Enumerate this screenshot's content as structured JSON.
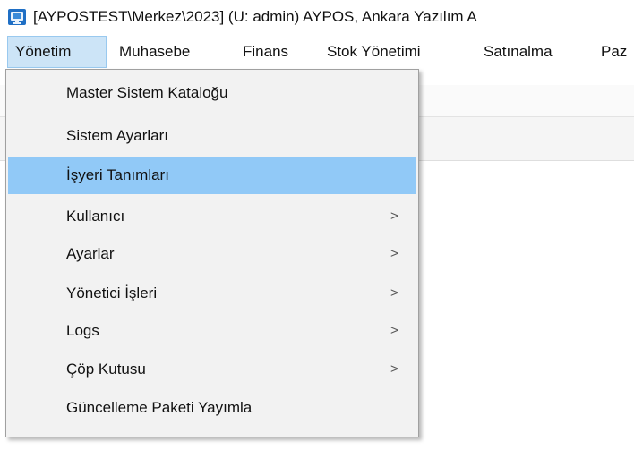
{
  "window": {
    "title": "[AYPOSTEST\\Merkez\\2023] (U: admin) AYPOS, Ankara Yazılım A"
  },
  "menubar": {
    "items": [
      {
        "label": "Yönetim",
        "active": true
      },
      {
        "label": "Muhasebe"
      },
      {
        "label": "Finans"
      },
      {
        "label": "Stok Yönetimi"
      },
      {
        "label": "Satınalma"
      },
      {
        "label": "Paz"
      }
    ]
  },
  "dropdown": {
    "items": [
      {
        "label": "Master Sistem Kataloğu",
        "submenu": false
      },
      {
        "label": "Sistem Ayarları",
        "submenu": false
      },
      {
        "label": "İşyeri Tanımları",
        "submenu": false,
        "highlighted": true
      },
      {
        "label": "Kullanıcı",
        "submenu": true,
        "arrow": ">"
      },
      {
        "label": "Ayarlar",
        "submenu": true,
        "arrow": ">"
      },
      {
        "label": "Yönetici İşleri",
        "submenu": true,
        "arrow": ">"
      },
      {
        "label": "Logs",
        "submenu": true,
        "arrow": ">"
      },
      {
        "label": "Çöp Kutusu",
        "submenu": true,
        "arrow": ">"
      },
      {
        "label": "Güncelleme Paketi Yayımla",
        "submenu": false
      }
    ]
  },
  "colors": {
    "highlight": "#91c9f7",
    "menu_background": "#f2f2f2",
    "active_menubar": "#cce4f7",
    "app_icon": "#1f6fc5"
  },
  "icons": {
    "app": "app-logo-icon",
    "submenu": "chevron-right-icon"
  }
}
